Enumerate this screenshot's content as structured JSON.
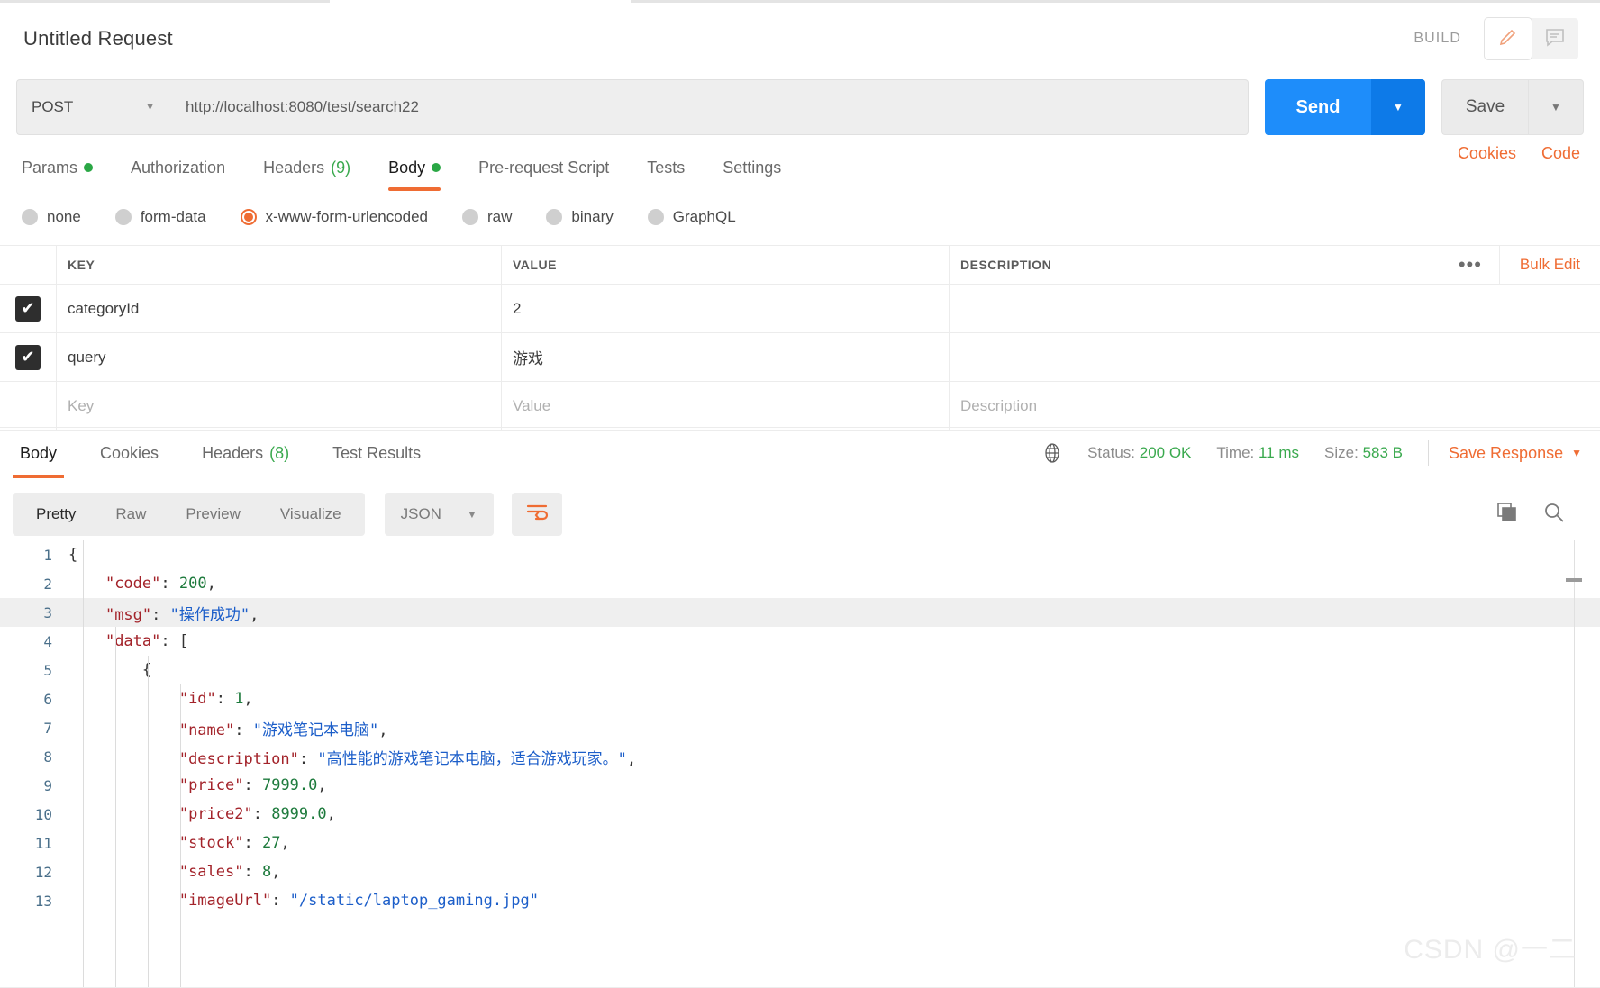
{
  "window": {
    "request_title": "Untitled Request",
    "build_label": "BUILD"
  },
  "url_bar": {
    "method": "POST",
    "method_caret": "▼",
    "url": "http://localhost:8080/test/search22",
    "send_label": "Send",
    "send_caret": "▼",
    "save_label": "Save",
    "save_caret": "▼"
  },
  "request_tabs": {
    "items": [
      {
        "label": "Params",
        "dot": true,
        "count": "",
        "active": false
      },
      {
        "label": "Authorization",
        "dot": false,
        "count": "",
        "active": false
      },
      {
        "label": "Headers",
        "dot": false,
        "count": "(9)",
        "active": false
      },
      {
        "label": "Body",
        "dot": true,
        "count": "",
        "active": true
      },
      {
        "label": "Pre-request Script",
        "dot": false,
        "count": "",
        "active": false
      },
      {
        "label": "Tests",
        "dot": false,
        "count": "",
        "active": false
      },
      {
        "label": "Settings",
        "dot": false,
        "count": "",
        "active": false
      }
    ],
    "cookies_link": "Cookies",
    "code_link": "Code"
  },
  "body_type": {
    "options": [
      {
        "label": "none",
        "selected": false
      },
      {
        "label": "form-data",
        "selected": false
      },
      {
        "label": "x-www-form-urlencoded",
        "selected": true
      },
      {
        "label": "raw",
        "selected": false
      },
      {
        "label": "binary",
        "selected": false
      },
      {
        "label": "GraphQL",
        "selected": false
      }
    ]
  },
  "kv_table": {
    "headers": {
      "key": "KEY",
      "value": "VALUE",
      "description": "DESCRIPTION"
    },
    "dots_label": "•••",
    "bulk_edit_label": "Bulk Edit",
    "check_glyph": "✔",
    "rows": [
      {
        "checked": true,
        "key": "categoryId",
        "value": "2",
        "description": ""
      },
      {
        "checked": true,
        "key": "query",
        "value": "游戏",
        "description": ""
      }
    ],
    "empty_row": {
      "key": "Key",
      "value": "Value",
      "description": "Description"
    }
  },
  "response_tabs": {
    "items": [
      {
        "label": "Body",
        "count": "",
        "active": true
      },
      {
        "label": "Cookies",
        "count": "",
        "active": false
      },
      {
        "label": "Headers",
        "count": "(8)",
        "active": false
      },
      {
        "label": "Test Results",
        "count": "",
        "active": false
      }
    ],
    "status_label": "Status:",
    "status_value": "200 OK",
    "time_label": "Time:",
    "time_value": "11 ms",
    "size_label": "Size:",
    "size_value": "583 B",
    "save_response_label": "Save Response",
    "save_response_caret": "▼"
  },
  "view_bar": {
    "modes": [
      {
        "label": "Pretty",
        "active": true
      },
      {
        "label": "Raw",
        "active": false
      },
      {
        "label": "Preview",
        "active": false
      },
      {
        "label": "Visualize",
        "active": false
      }
    ],
    "format": "JSON",
    "format_caret": "▼"
  },
  "response_body": {
    "lines": [
      {
        "num": "1",
        "indent": 0,
        "highlight": false,
        "tokens": [
          {
            "t": "p",
            "v": "{"
          }
        ]
      },
      {
        "num": "2",
        "indent": 1,
        "highlight": false,
        "tokens": [
          {
            "t": "k",
            "v": "\"code\""
          },
          {
            "t": "p",
            "v": ": "
          },
          {
            "t": "n",
            "v": "200"
          },
          {
            "t": "p",
            "v": ","
          }
        ]
      },
      {
        "num": "3",
        "indent": 1,
        "highlight": true,
        "tokens": [
          {
            "t": "k",
            "v": "\"msg\""
          },
          {
            "t": "p",
            "v": ": "
          },
          {
            "t": "s",
            "v": "\"操作成功\""
          },
          {
            "t": "p",
            "v": ","
          }
        ]
      },
      {
        "num": "4",
        "indent": 1,
        "highlight": false,
        "tokens": [
          {
            "t": "k",
            "v": "\"data\""
          },
          {
            "t": "p",
            "v": ": ["
          }
        ]
      },
      {
        "num": "5",
        "indent": 2,
        "highlight": false,
        "tokens": [
          {
            "t": "p",
            "v": "{"
          }
        ]
      },
      {
        "num": "6",
        "indent": 3,
        "highlight": false,
        "tokens": [
          {
            "t": "k",
            "v": "\"id\""
          },
          {
            "t": "p",
            "v": ": "
          },
          {
            "t": "n",
            "v": "1"
          },
          {
            "t": "p",
            "v": ","
          }
        ]
      },
      {
        "num": "7",
        "indent": 3,
        "highlight": false,
        "tokens": [
          {
            "t": "k",
            "v": "\"name\""
          },
          {
            "t": "p",
            "v": ": "
          },
          {
            "t": "s",
            "v": "\"游戏笔记本电脑\""
          },
          {
            "t": "p",
            "v": ","
          }
        ]
      },
      {
        "num": "8",
        "indent": 3,
        "highlight": false,
        "tokens": [
          {
            "t": "k",
            "v": "\"description\""
          },
          {
            "t": "p",
            "v": ": "
          },
          {
            "t": "s",
            "v": "\"高性能的游戏笔记本电脑，适合游戏玩家。\""
          },
          {
            "t": "p",
            "v": ","
          }
        ]
      },
      {
        "num": "9",
        "indent": 3,
        "highlight": false,
        "tokens": [
          {
            "t": "k",
            "v": "\"price\""
          },
          {
            "t": "p",
            "v": ": "
          },
          {
            "t": "n",
            "v": "7999.0"
          },
          {
            "t": "p",
            "v": ","
          }
        ]
      },
      {
        "num": "10",
        "indent": 3,
        "highlight": false,
        "tokens": [
          {
            "t": "k",
            "v": "\"price2\""
          },
          {
            "t": "p",
            "v": ": "
          },
          {
            "t": "n",
            "v": "8999.0"
          },
          {
            "t": "p",
            "v": ","
          }
        ]
      },
      {
        "num": "11",
        "indent": 3,
        "highlight": false,
        "tokens": [
          {
            "t": "k",
            "v": "\"stock\""
          },
          {
            "t": "p",
            "v": ": "
          },
          {
            "t": "n",
            "v": "27"
          },
          {
            "t": "p",
            "v": ","
          }
        ]
      },
      {
        "num": "12",
        "indent": 3,
        "highlight": false,
        "tokens": [
          {
            "t": "k",
            "v": "\"sales\""
          },
          {
            "t": "p",
            "v": ": "
          },
          {
            "t": "n",
            "v": "8"
          },
          {
            "t": "p",
            "v": ","
          }
        ]
      },
      {
        "num": "13",
        "indent": 3,
        "highlight": false,
        "tokens": [
          {
            "t": "k",
            "v": "\"imageUrl\""
          },
          {
            "t": "p",
            "v": ": "
          },
          {
            "t": "s",
            "v": "\"/static/laptop_gaming.jpg\""
          }
        ]
      }
    ]
  },
  "watermark": "CSDN @一二",
  "colors": {
    "accent_orange": "#ef6c33",
    "send_blue": "#1e8dfa",
    "status_green": "#3aa94e",
    "json_key": "#a3232a",
    "json_string": "#1c5ec9",
    "json_number": "#1d7a3c"
  }
}
